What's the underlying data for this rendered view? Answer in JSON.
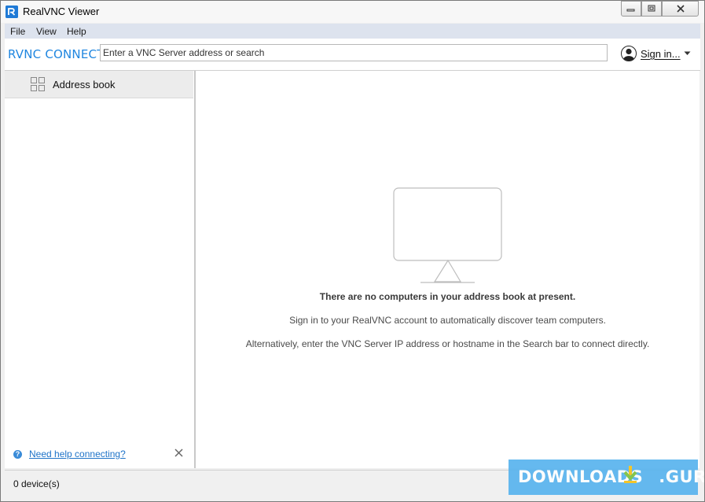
{
  "window": {
    "title": "RealVNC Viewer"
  },
  "menu": {
    "items": [
      {
        "label": "File"
      },
      {
        "label": "View"
      },
      {
        "label": "Help"
      }
    ]
  },
  "toolbar": {
    "brand": "RVNC CONNECT",
    "search_placeholder": "Enter a VNC Server address or search",
    "search_value": "",
    "signin_label": "Sign in..."
  },
  "sidebar": {
    "address_book_label": "Address book",
    "help_link": "Need help connecting?"
  },
  "main": {
    "empty_title": "There are no computers in your address book at present.",
    "empty_line1": "Sign in to your RealVNC account to automatically discover team computers.",
    "empty_line2": "Alternatively, enter the VNC Server IP address or hostname in the Search bar to connect directly."
  },
  "status": {
    "device_count": "0 device(s)"
  },
  "watermark": {
    "text_left": "DOWNLOADS",
    "text_right": ".GURU"
  },
  "colors": {
    "accent": "#1f86e0",
    "link": "#1e73c8",
    "menu_bg": "#dde3ee",
    "watermark_bg": "#59b4ee"
  },
  "icons": {
    "app": "realvnc-app-icon",
    "avatar": "user-avatar-icon",
    "address_book": "grid-icon",
    "help": "question-icon",
    "close": "close-icon",
    "monitor": "monitor-icon"
  }
}
